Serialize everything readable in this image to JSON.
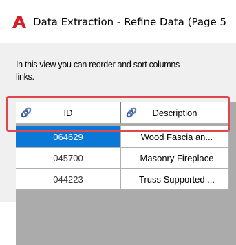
{
  "window": {
    "title": "Data Extraction - Refine Data (Page 5"
  },
  "instructions": {
    "line1": "In this view you can reorder and sort columns",
    "line2": "links."
  },
  "table": {
    "columns": [
      {
        "label": "ID"
      },
      {
        "label": "Description"
      }
    ],
    "rows": [
      {
        "id": "064629",
        "description": "Wood Fascia an...",
        "selected": true
      },
      {
        "id": "045700",
        "description": "Masonry Fireplace",
        "selected": false
      },
      {
        "id": "044223",
        "description": "Truss Supported ...",
        "selected": false
      }
    ]
  },
  "colors": {
    "selection": "#0a78d7",
    "highlight": "#e0474c",
    "app_icon": "#d42027",
    "link_icon": "#3b5a8a"
  }
}
